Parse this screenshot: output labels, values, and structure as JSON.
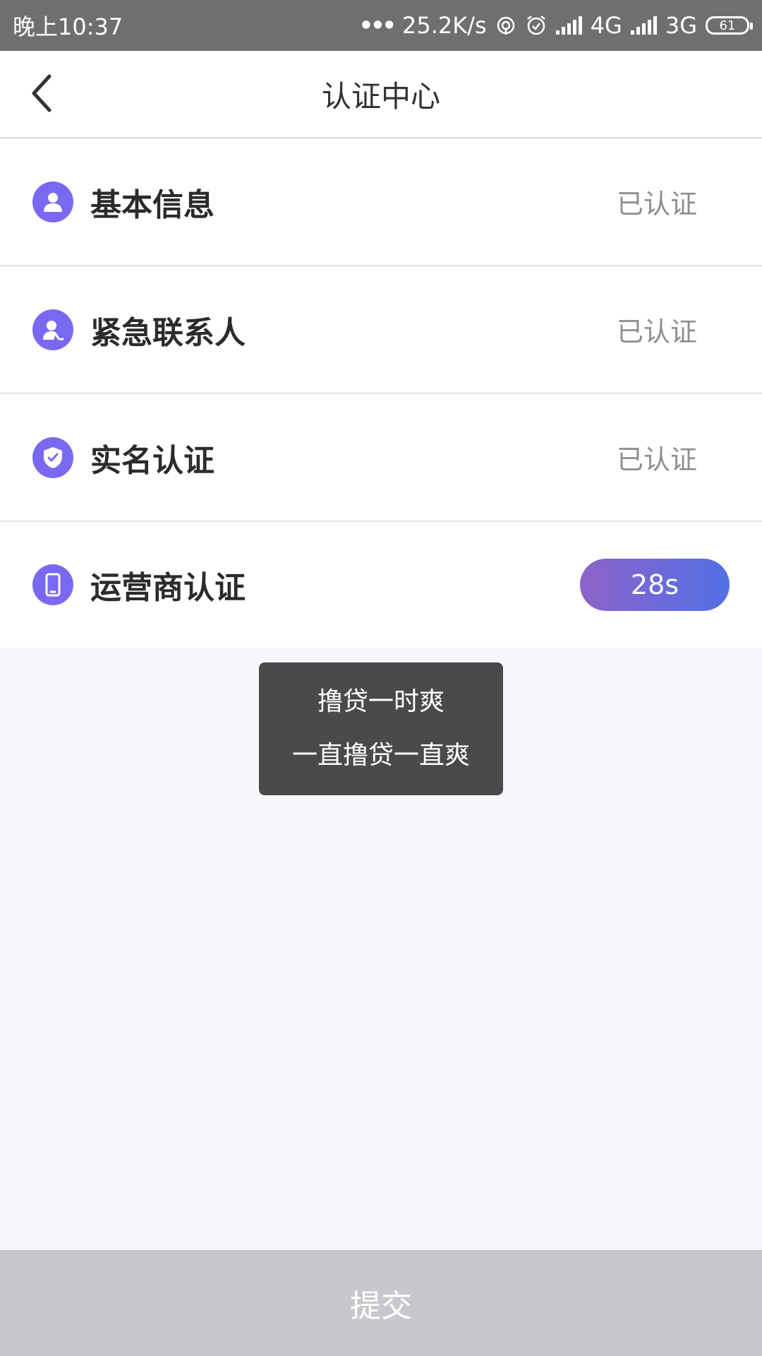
{
  "status_bar": {
    "time": "晚上10:37",
    "dots": "•••",
    "network_speed": "25.2K/s",
    "network_1": "4G",
    "network_2": "3G",
    "battery_level": "61",
    "icons": [
      "hotspot-icon",
      "alarm-icon",
      "signal-icon",
      "signal-icon",
      "battery-icon"
    ]
  },
  "header": {
    "title": "认证中心",
    "back_icon": "chevron-left-icon"
  },
  "items": [
    {
      "label": "基本信息",
      "status": "已认证",
      "icon": "user-icon"
    },
    {
      "label": "紧急联系人",
      "status": "已认证",
      "icon": "contact-phone-icon"
    },
    {
      "label": "实名认证",
      "status": "已认证",
      "icon": "shield-check-icon"
    },
    {
      "label": "运营商认证",
      "countdown": "28s",
      "icon": "mobile-phone-icon"
    }
  ],
  "toast": {
    "line1": "撸贷一时爽",
    "line2": "一直撸贷一直爽"
  },
  "submit": {
    "label": "提交"
  },
  "colors": {
    "accent": "#7b68f0",
    "gradient_start": "#8e63c8",
    "gradient_end": "#5170e6",
    "submit_disabled": "#c7c8cc",
    "background": "#f6f7fb"
  }
}
